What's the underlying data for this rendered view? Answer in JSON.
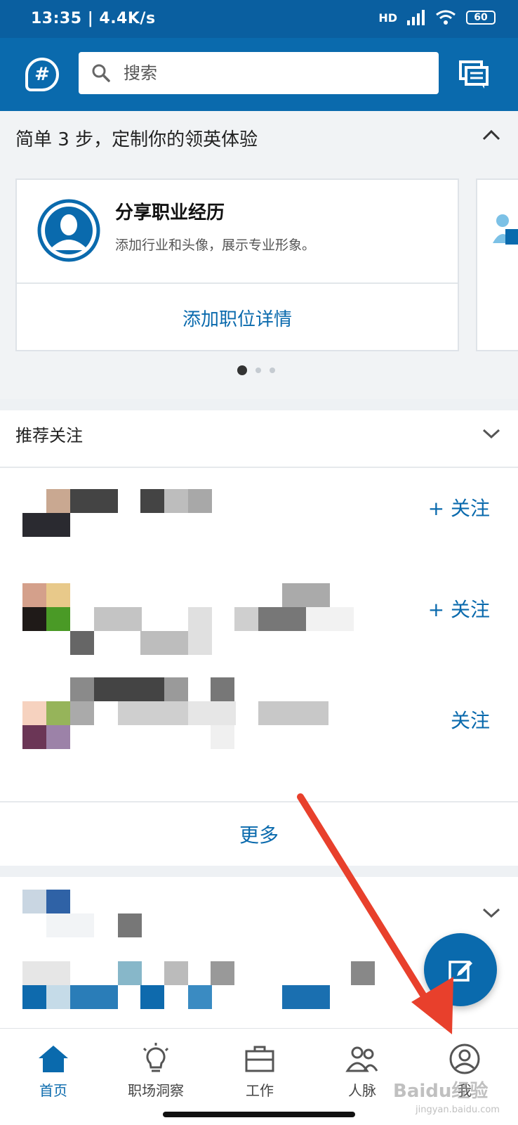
{
  "status_bar": {
    "time": "13:35 | 4.4K/s",
    "network": "HD",
    "battery": "60"
  },
  "header": {
    "search_placeholder": "搜索"
  },
  "onboarding": {
    "title": "简单 3 步，定制你的领英体验",
    "card": {
      "title": "分享职业经历",
      "subtitle": "添加行业和头像，展示专业形象。",
      "action": "添加职位详情"
    },
    "pager": {
      "current": 1,
      "total": 3
    }
  },
  "recommendations": {
    "title": "推荐关注",
    "items": [
      {
        "follow_label": "+ 关注"
      },
      {
        "follow_label": "+ 关注"
      },
      {
        "follow_label": "关注"
      }
    ],
    "more_label": "更多"
  },
  "tabs": [
    {
      "label": "首页",
      "icon": "home-icon",
      "active": true
    },
    {
      "label": "职场洞察",
      "icon": "lightbulb-icon",
      "active": false
    },
    {
      "label": "工作",
      "icon": "briefcase-icon",
      "active": false
    },
    {
      "label": "人脉",
      "icon": "people-icon",
      "active": false
    },
    {
      "label": "我",
      "icon": "profile-icon",
      "active": false
    }
  ],
  "watermark": {
    "text": "Baidu经验",
    "sub": "jingyan.baidu.com"
  },
  "colors": {
    "brand": "#0a6aad",
    "statusbar": "#0a5fa0",
    "annotation_arrow": "#e8402c"
  }
}
